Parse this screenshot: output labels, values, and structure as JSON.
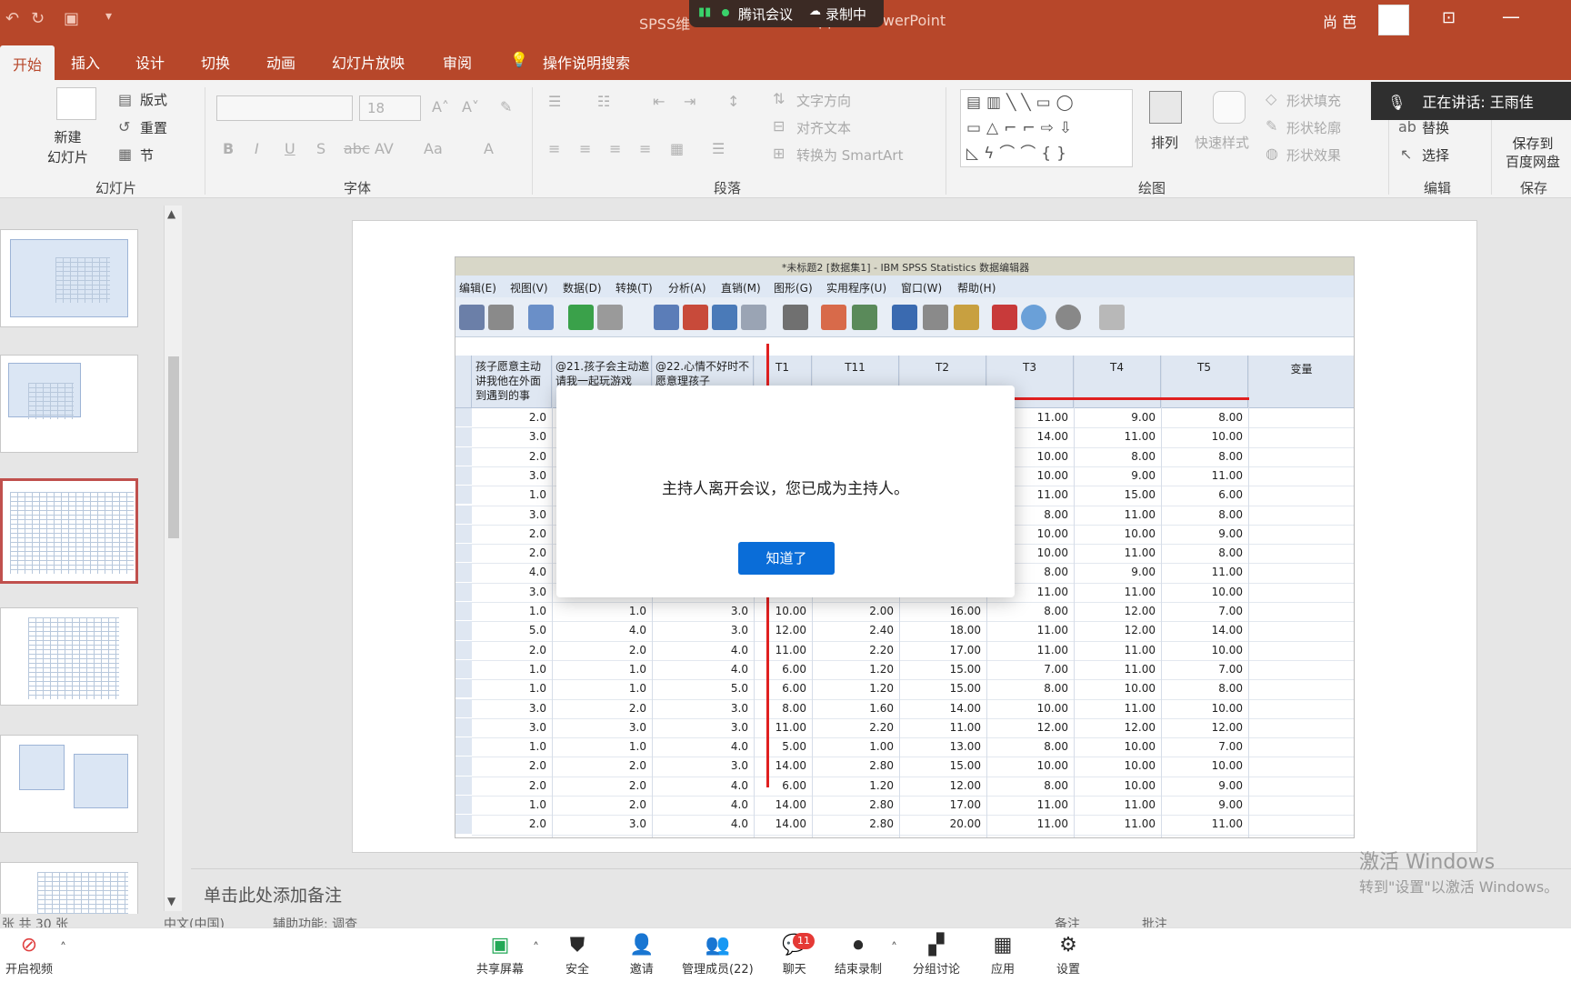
{
  "title_bar": {
    "doc_title_prefix": "SPSS维",
    "doc_title_suffix": "pptx - PowerPoint",
    "meeting_app": "腾讯会议",
    "recording": "录制中",
    "user_name": "尚 芭"
  },
  "ribbon_tabs": [
    "开始",
    "插入",
    "设计",
    "切换",
    "动画",
    "幻灯片放映",
    "审阅"
  ],
  "tell_me": "操作说明搜索",
  "ribbon": {
    "slides_group": {
      "new_slide": "新建\n幻灯片",
      "layout": "版式",
      "reset": "重置",
      "section": "节",
      "label": "幻灯片"
    },
    "font_group": {
      "font_size": "18",
      "label": "字体"
    },
    "paragraph_group": {
      "text_direction": "文字方向",
      "align_text": "对齐文本",
      "smartart": "转换为 SmartArt",
      "label": "段落"
    },
    "drawing_group": {
      "arrange": "排列",
      "quick_styles": "快速样式",
      "shape_fill": "形状填充",
      "shape_outline": "形状轮廓",
      "shape_effects": "形状效果",
      "label": "绘图"
    },
    "editing_group": {
      "replace": "替换",
      "select": "选择",
      "label": "编辑"
    },
    "save_group": {
      "save_to": "保存到\n百度网盘",
      "label": "保存"
    }
  },
  "speaking_now": "正在讲话: 王雨佳",
  "spss": {
    "title": "*未标题2 [数据集1] - IBM SPSS Statistics 数据编辑器",
    "menu": [
      "编辑(E)",
      "视图(V)",
      "数据(D)",
      "转换(T)",
      "分析(A)",
      "直销(M)",
      "图形(G)",
      "实用程序(U)",
      "窗口(W)",
      "帮助(H)"
    ],
    "headers": [
      "孩子愿意主动\n讲我他在外面\n到遇到的事",
      "@21.孩子会主动邀\n请我一起玩游戏",
      "@22.心情不好时不\n愿意理孩子",
      "T1",
      "T11",
      "T2",
      "T3",
      "T4",
      "T5",
      "变量"
    ],
    "rows": [
      [
        "2.0",
        "",
        "",
        "",
        "",
        "",
        "11.00",
        "9.00",
        "8.00"
      ],
      [
        "3.0",
        "",
        "",
        "",
        "",
        "",
        "14.00",
        "11.00",
        "10.00"
      ],
      [
        "2.0",
        "",
        "",
        "",
        "",
        "",
        "10.00",
        "8.00",
        "8.00"
      ],
      [
        "3.0",
        "",
        "",
        "",
        "",
        "",
        "10.00",
        "9.00",
        "11.00"
      ],
      [
        "1.0",
        "",
        "",
        "",
        "",
        "",
        "11.00",
        "15.00",
        "6.00"
      ],
      [
        "3.0",
        "",
        "",
        "",
        "",
        "",
        "8.00",
        "11.00",
        "8.00"
      ],
      [
        "2.0",
        "",
        "",
        "",
        "",
        "",
        "10.00",
        "10.00",
        "9.00"
      ],
      [
        "2.0",
        "",
        "",
        "",
        "",
        "",
        "10.00",
        "11.00",
        "8.00"
      ],
      [
        "4.0",
        "",
        "",
        "",
        "",
        "",
        "8.00",
        "9.00",
        "11.00"
      ],
      [
        "3.0",
        "",
        "",
        "",
        "",
        "",
        "11.00",
        "11.00",
        "10.00"
      ],
      [
        "1.0",
        "1.0",
        "3.0",
        "10.00",
        "2.00",
        "16.00",
        "8.00",
        "12.00",
        "7.00"
      ],
      [
        "5.0",
        "4.0",
        "3.0",
        "12.00",
        "2.40",
        "18.00",
        "11.00",
        "12.00",
        "14.00"
      ],
      [
        "2.0",
        "2.0",
        "4.0",
        "11.00",
        "2.20",
        "17.00",
        "11.00",
        "11.00",
        "10.00"
      ],
      [
        "1.0",
        "1.0",
        "4.0",
        "6.00",
        "1.20",
        "15.00",
        "7.00",
        "11.00",
        "7.00"
      ],
      [
        "1.0",
        "1.0",
        "5.0",
        "6.00",
        "1.20",
        "15.00",
        "8.00",
        "10.00",
        "8.00"
      ],
      [
        "3.0",
        "2.0",
        "3.0",
        "8.00",
        "1.60",
        "14.00",
        "10.00",
        "11.00",
        "10.00"
      ],
      [
        "3.0",
        "3.0",
        "3.0",
        "11.00",
        "2.20",
        "11.00",
        "12.00",
        "12.00",
        "12.00"
      ],
      [
        "1.0",
        "1.0",
        "4.0",
        "5.00",
        "1.00",
        "13.00",
        "8.00",
        "10.00",
        "7.00"
      ],
      [
        "2.0",
        "2.0",
        "3.0",
        "14.00",
        "2.80",
        "15.00",
        "10.00",
        "10.00",
        "10.00"
      ],
      [
        "2.0",
        "2.0",
        "4.0",
        "6.00",
        "1.20",
        "12.00",
        "8.00",
        "10.00",
        "9.00"
      ],
      [
        "1.0",
        "2.0",
        "4.0",
        "14.00",
        "2.80",
        "17.00",
        "11.00",
        "11.00",
        "9.00"
      ],
      [
        "2.0",
        "3.0",
        "4.0",
        "14.00",
        "2.80",
        "20.00",
        "11.00",
        "11.00",
        "11.00"
      ]
    ]
  },
  "dialog": {
    "message": "主持人离开会议，您已成为主持人。",
    "button": "知道了"
  },
  "notes_placeholder": "单击此处添加备注",
  "status": {
    "slide_info": "张 共 30 张",
    "language": "中文(中国)",
    "accessibility": "辅助功能: 调查",
    "notes": "备注",
    "comments": "批注"
  },
  "watermark": {
    "line1": "激活 Windows",
    "line2": "转到\"设置\"以激活 Windows。"
  },
  "meeting_bar": {
    "items": [
      "开启视频",
      "共享屏幕",
      "安全",
      "邀请",
      "管理成员(22)",
      "聊天",
      "结束录制",
      "分组讨论",
      "应用",
      "设置"
    ],
    "chat_badge": "11"
  },
  "colors": {
    "accent": "#b7472a",
    "dialog_button": "#0a6dd8",
    "annotation_red": "#e02020"
  }
}
